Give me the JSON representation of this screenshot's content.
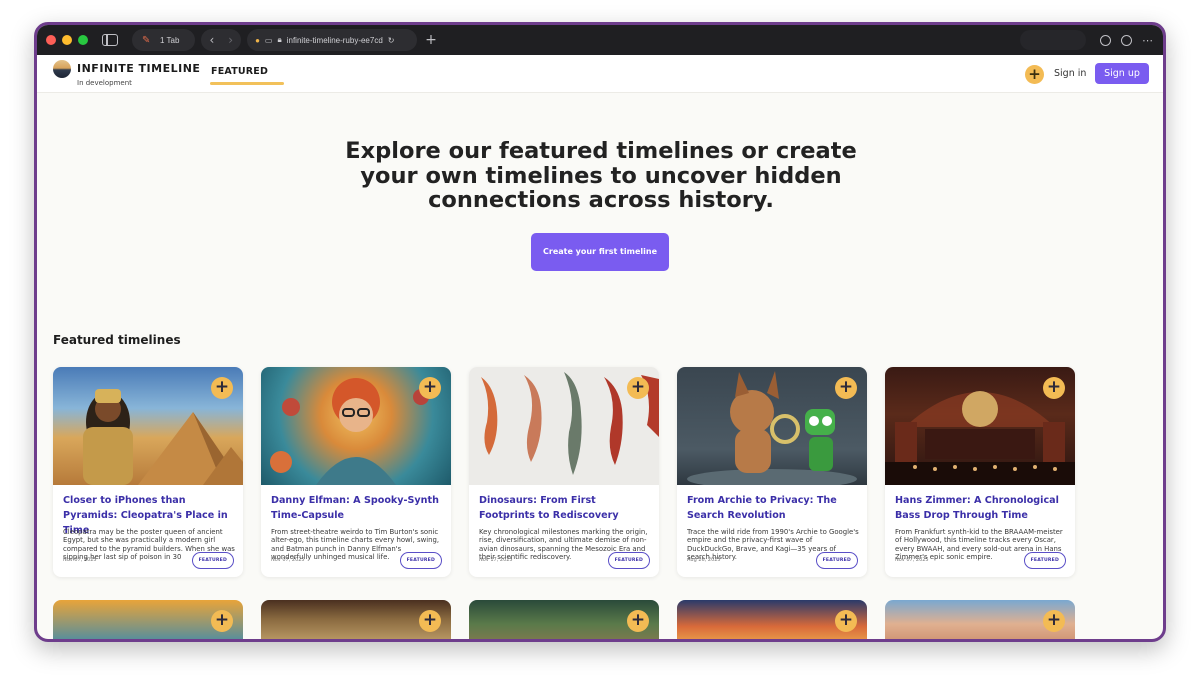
{
  "browser": {
    "tab_count": "1 Tab",
    "url": "infinite-timeline-ruby-ee7cd"
  },
  "header": {
    "brand": "INFINITE TIMELINE",
    "tagline": "In development",
    "nav_featured": "FEATURED",
    "add_symbol": "+",
    "sign_in": "Sign in",
    "sign_up": "Sign up"
  },
  "hero": {
    "title": "Explore our featured timelines or create your own timelines to uncover hidden connections across history.",
    "cta": "Create your first timeline"
  },
  "section_title": "Featured timelines",
  "cards": [
    {
      "title": "Closer to iPhones than Pyramids: Cleopatra's Place in Time",
      "description": "Cleopatra may be the poster queen of ancient Egypt, but she was practically a modern girl compared to the pyramid builders. When she was sipping her last sip of poison in 30",
      "date": "Nov 07, 2025",
      "badge": "FEATURED",
      "plus": "+"
    },
    {
      "title": "Danny Elfman: A Spooky-Synth Time-Capsule",
      "description": "From street-theatre weirdo to Tim Burton's sonic alter-ego, this timeline charts every howl, swing, and Batman punch in Danny Elfman's wonderfully unhinged musical life.",
      "date": "Nov 07, 2025",
      "badge": "FEATURED",
      "plus": "+"
    },
    {
      "title": "Dinosaurs: From First Footprints to Rediscovery",
      "description": "Key chronological milestones marking the origin, rise, diversification, and ultimate demise of non-avian dinosaurs, spanning the Mesozoic Era and their scientific rediscovery.",
      "date": "Nov 17, 2025",
      "badge": "FEATURED",
      "plus": "+"
    },
    {
      "title": "From Archie to Privacy: The Search Revolution",
      "description": "Trace the wild ride from 1990's Archie to Google's empire and the privacy-first wave of DuckDuckGo, Brave, and Kagi—35 years of search history.",
      "date": "Aug 26, 2025",
      "badge": "FEATURED",
      "plus": "+"
    },
    {
      "title": "Hans Zimmer: A Chronological Bass Drop Through Time",
      "description": "From Frankfurt synth-kid to the BRAAAM-meister of Hollywood, this timeline tracks every Oscar, every BWAAH, and every sold-out arena in Hans Zimmer's epic sonic empire.",
      "date": "Nov 07, 2025",
      "badge": "FEATURED",
      "plus": "+"
    }
  ],
  "row2_plus": "+",
  "colors": {
    "accent_purple": "#7a5cf0",
    "accent_yellow": "#f3bb54",
    "title_blue": "#3b2fa8",
    "frame": "#6e3d8c"
  }
}
